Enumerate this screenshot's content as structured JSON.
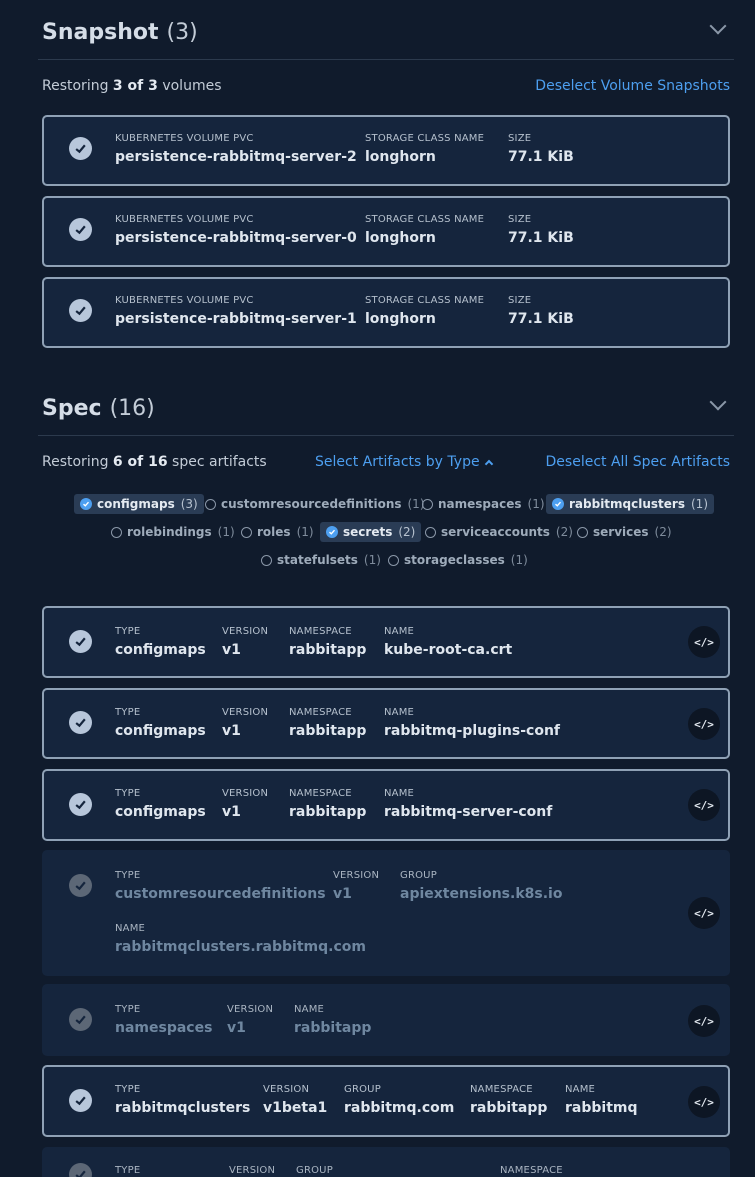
{
  "snapshot": {
    "title": "Snapshot",
    "count": "(3)",
    "summary_prefix": "Restoring ",
    "summary_bold": "3 of 3",
    "summary_suffix": " volumes",
    "deselect_label": "Deselect Volume Snapshots",
    "volumes": [
      {
        "pvc_label": "KUBERNETES VOLUME PVC",
        "pvc": "persistence-rabbitmq-server-2",
        "sc_label": "STORAGE CLASS NAME",
        "sc": "longhorn",
        "size_label": "SIZE",
        "size": "77.1 KiB"
      },
      {
        "pvc_label": "KUBERNETES VOLUME PVC",
        "pvc": "persistence-rabbitmq-server-0",
        "sc_label": "STORAGE CLASS NAME",
        "sc": "longhorn",
        "size_label": "SIZE",
        "size": "77.1 KiB"
      },
      {
        "pvc_label": "KUBERNETES VOLUME PVC",
        "pvc": "persistence-rabbitmq-server-1",
        "sc_label": "STORAGE CLASS NAME",
        "sc": "longhorn",
        "size_label": "SIZE",
        "size": "77.1 KiB"
      }
    ]
  },
  "spec": {
    "title": "Spec",
    "count": "(16)",
    "summary_prefix": "Restoring ",
    "summary_bold": "6 of 16",
    "summary_suffix": " spec artifacts",
    "select_by_type_label": "Select Artifacts by Type",
    "deselect_label": "Deselect All Spec Artifacts",
    "chips": [
      {
        "name": "configmaps",
        "count": "(3)",
        "selected": true
      },
      {
        "name": "customresourcedefinitions",
        "count": "(1)",
        "selected": false
      },
      {
        "name": "namespaces",
        "count": "(1)",
        "selected": false
      },
      {
        "name": "rabbitmqclusters",
        "count": "(1)",
        "selected": true
      },
      {
        "name": "rolebindings",
        "count": "(1)",
        "selected": false
      },
      {
        "name": "roles",
        "count": "(1)",
        "selected": false
      },
      {
        "name": "secrets",
        "count": "(2)",
        "selected": true
      },
      {
        "name": "serviceaccounts",
        "count": "(2)",
        "selected": false
      },
      {
        "name": "services",
        "count": "(2)",
        "selected": false
      },
      {
        "name": "statefulsets",
        "count": "(1)",
        "selected": false
      },
      {
        "name": "storageclasses",
        "count": "(1)",
        "selected": false
      }
    ],
    "artifacts": [
      {
        "type_label": "TYPE",
        "type": "configmaps",
        "version_label": "VERSION",
        "version": "v1",
        "namespace_label": "NAMESPACE",
        "namespace": "rabbitapp",
        "name_label": "NAME",
        "name": "kube-root-ca.crt"
      },
      {
        "type_label": "TYPE",
        "type": "configmaps",
        "version_label": "VERSION",
        "version": "v1",
        "namespace_label": "NAMESPACE",
        "namespace": "rabbitapp",
        "name_label": "NAME",
        "name": "rabbitmq-plugins-conf"
      },
      {
        "type_label": "TYPE",
        "type": "configmaps",
        "version_label": "VERSION",
        "version": "v1",
        "namespace_label": "NAMESPACE",
        "namespace": "rabbitapp",
        "name_label": "NAME",
        "name": "rabbitmq-server-conf"
      },
      {
        "type_label": "TYPE",
        "type": "customresourcedefinitions",
        "version_label": "VERSION",
        "version": "v1",
        "group_label": "GROUP",
        "group": "apiextensions.k8s.io",
        "name_label": "NAME",
        "name": "rabbitmqclusters.rabbitmq.com"
      },
      {
        "type_label": "TYPE",
        "type": "namespaces",
        "version_label": "VERSION",
        "version": "v1",
        "name_label": "NAME",
        "name": "rabbitapp"
      },
      {
        "type_label": "TYPE",
        "type": "rabbitmqclusters",
        "version_label": "VERSION",
        "version": "v1beta1",
        "group_label": "GROUP",
        "group": "rabbitmq.com",
        "namespace_label": "NAMESPACE",
        "namespace": "rabbitapp",
        "name_label": "NAME",
        "name": "rabbitmq"
      },
      {
        "type_label": "TYPE",
        "version_label": "VERSION",
        "group_label": "GROUP",
        "namespace_label": "NAMESPACE"
      }
    ],
    "code_button_glyph": "</>"
  }
}
